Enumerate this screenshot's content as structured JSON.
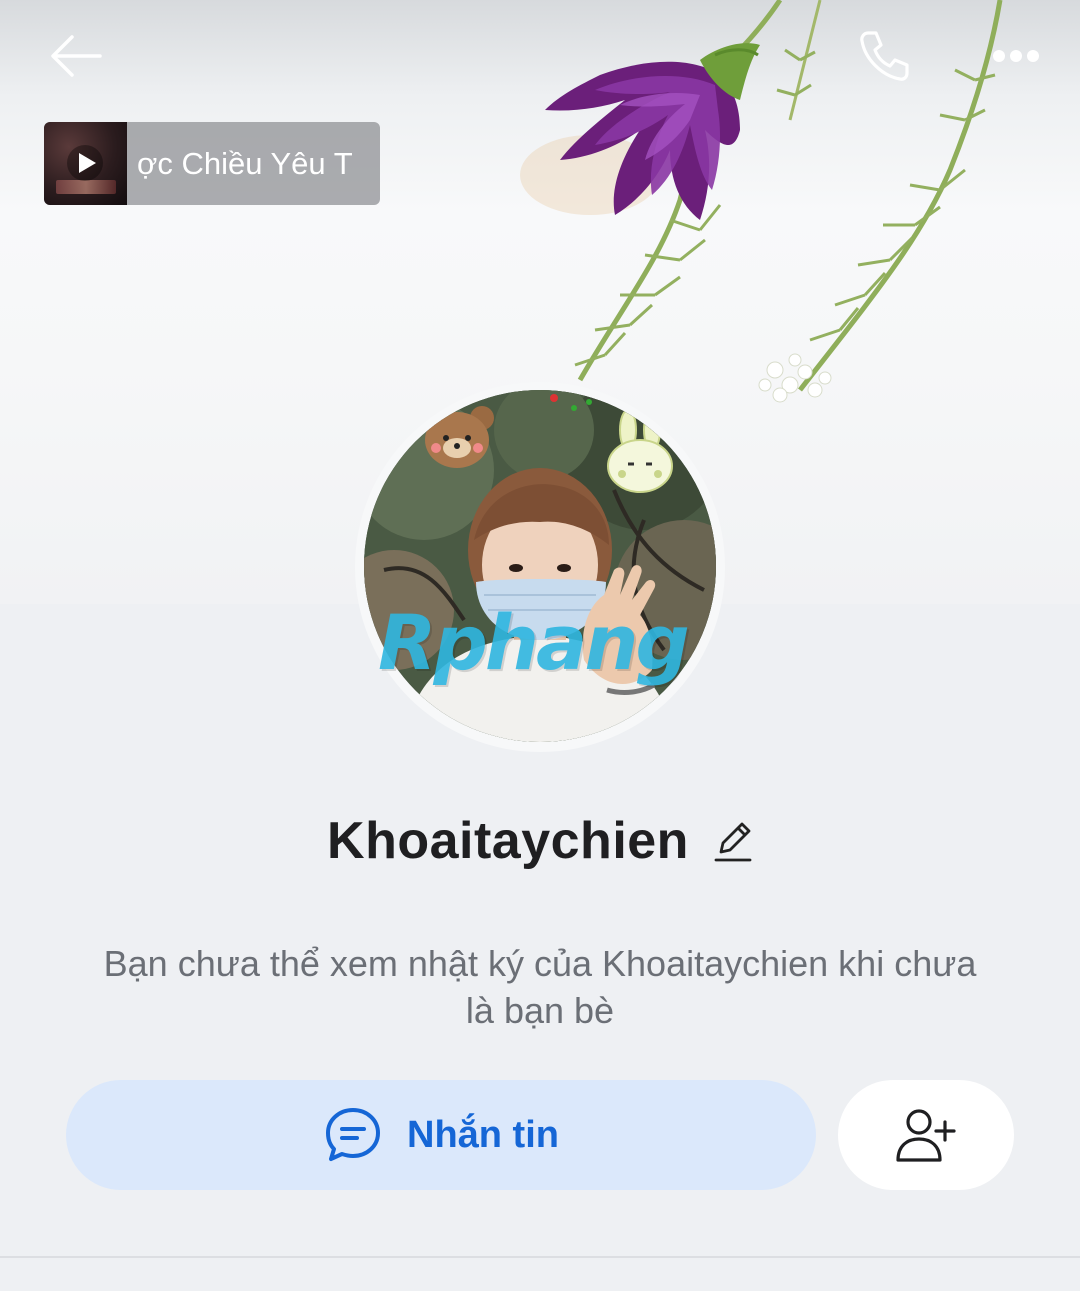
{
  "header": {
    "back_icon": "arrow-left-icon",
    "call_icon": "phone-icon",
    "more_icon": "more-horizontal-icon"
  },
  "music": {
    "title": "ợc Chiều Yêu T",
    "cover_icon": "play-icon"
  },
  "profile": {
    "name": "Khoaitaychien",
    "edit_icon": "pencil-icon",
    "watermark": "Rphang",
    "info_text_line1": "Bạn chưa thể xem nhật ký của Khoaitaychien khi chưa",
    "info_text_line2": "là bạn bè"
  },
  "actions": {
    "message_label": "Nhắn tin",
    "message_icon": "chat-bubble-icon",
    "add_friend_icon": "add-user-icon"
  },
  "colors": {
    "accent": "#1566d6",
    "message_button_bg": "#dbe8fb",
    "page_bg": "#eef0f3"
  }
}
